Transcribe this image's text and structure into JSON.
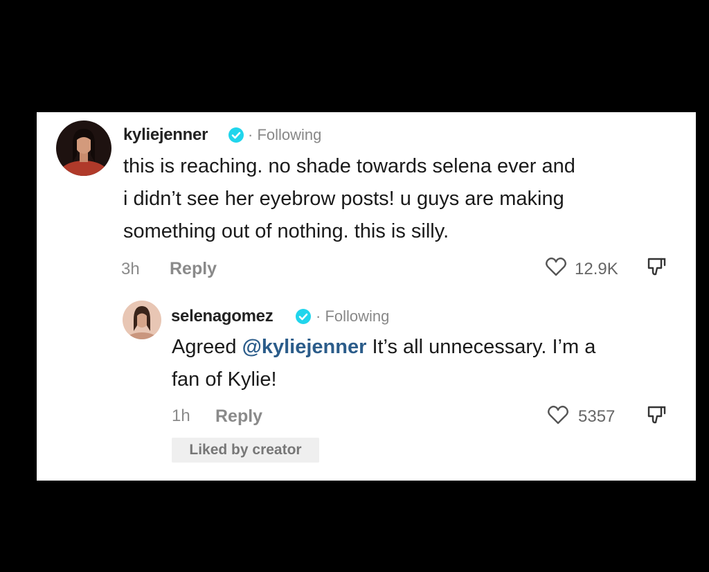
{
  "comments": [
    {
      "username": "kyliejenner",
      "following": "· Following",
      "lines": [
        "this is reaching. no shade towards selena ever and",
        "i didn’t see her eyebrow posts! u guys are making",
        "something out of nothing. this is silly."
      ],
      "time": "3h",
      "reply_label": "Reply",
      "likes": "12.9K"
    },
    {
      "username": "selenagomez",
      "following": "· Following",
      "prefix": "Agreed ",
      "mention": "@kyliejenner",
      "suffix": " It’s all unnecessary. I’m a",
      "line2": "fan of Kylie!",
      "time": "1h",
      "reply_label": "Reply",
      "likes": "5357",
      "badge": "Liked by creator"
    }
  ],
  "colors": {
    "verified": "#20d5ec",
    "mention": "#2b5c8a",
    "background": "#000000",
    "card": "#ffffff"
  },
  "icons": [
    "verified-badge-icon",
    "heart-icon",
    "dislike-icon"
  ]
}
